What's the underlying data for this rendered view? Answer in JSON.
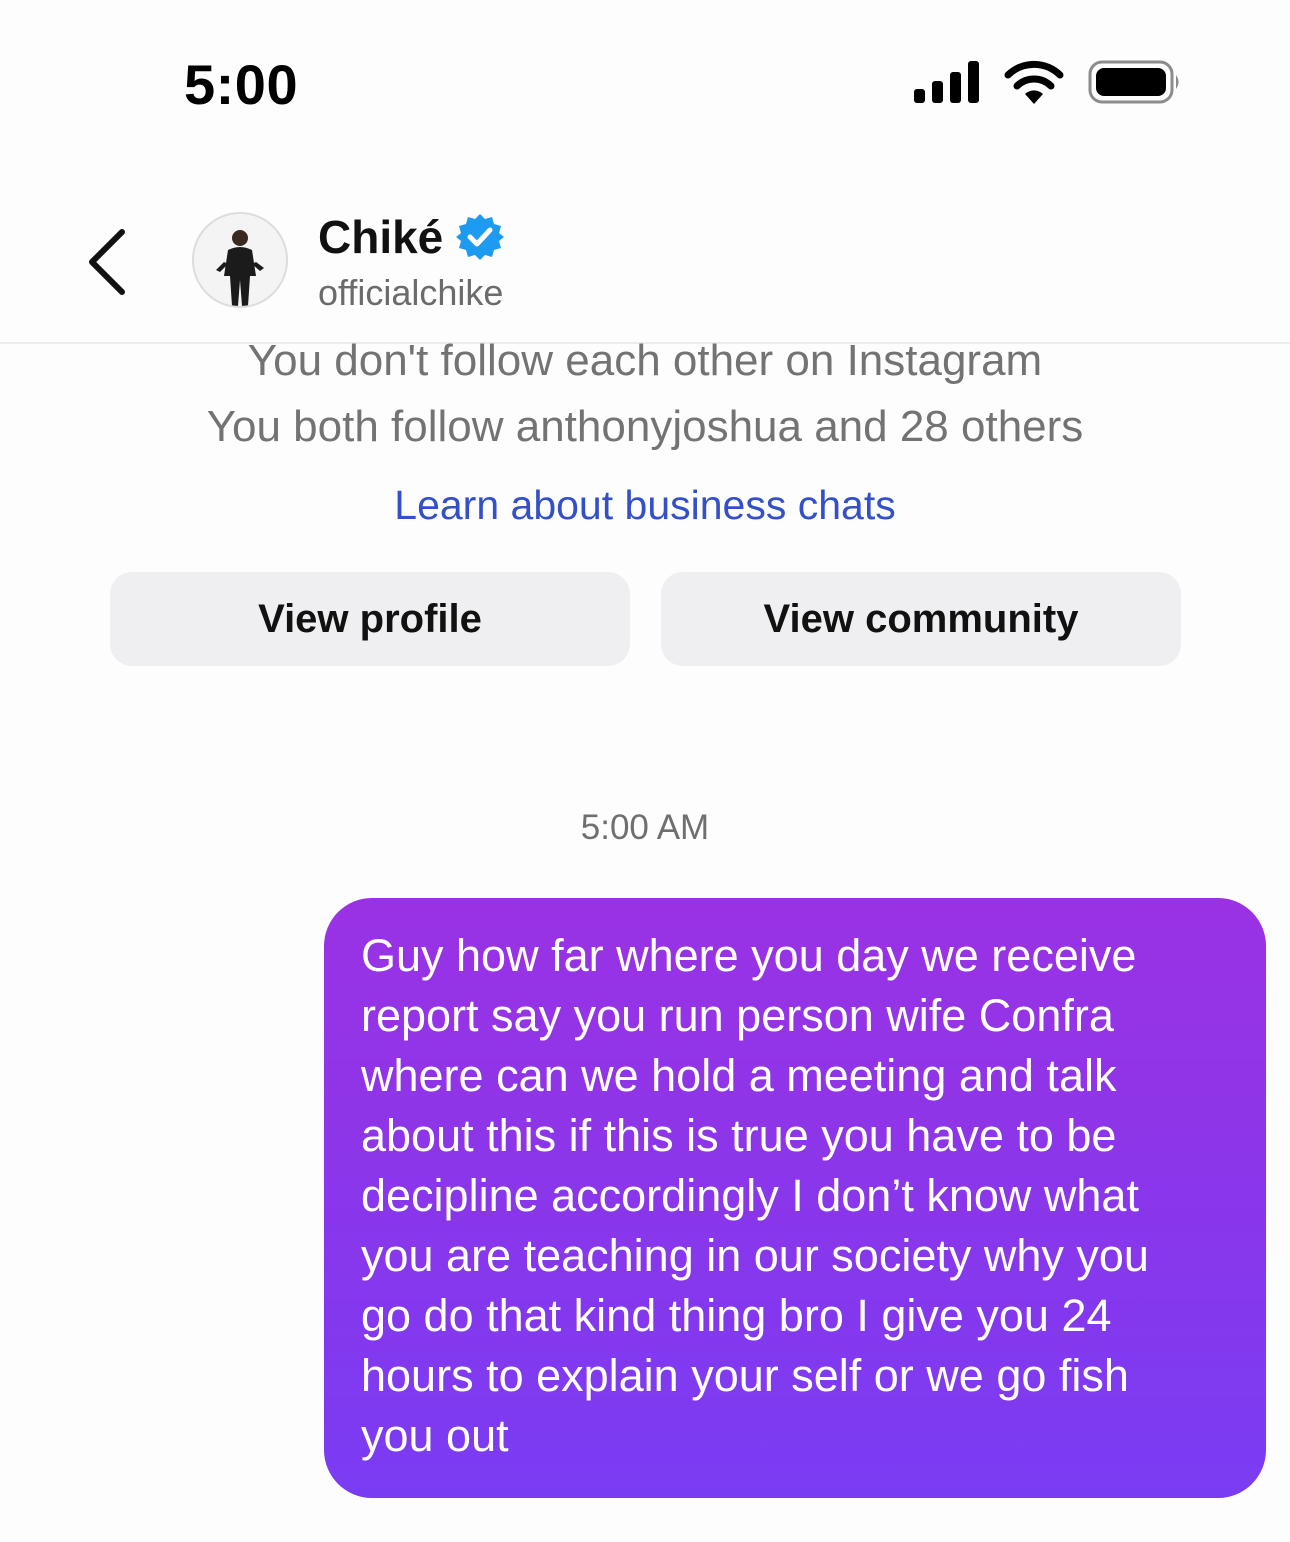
{
  "status_bar": {
    "time": "5:00"
  },
  "header": {
    "back_icon": "chevron-left-icon",
    "name": "Chiké",
    "verified_icon": "verified-badge-icon",
    "username": "officialchike"
  },
  "info": {
    "line1": "You don't follow each other on Instagram",
    "line2": "You both follow anthonyjoshua and 28 others",
    "learn_link": "Learn about business chats"
  },
  "actions": {
    "view_profile": "View profile",
    "view_community": "View community"
  },
  "thread": {
    "timestamp": "5:00 AM",
    "message": {
      "lines": [
        "Guy how far where you day we receive",
        "report say you run person wife Confra",
        "where can we hold a meeting and talk",
        "about this if this is true you have to be",
        "decipline accordingly I don’t know what",
        "you are teaching in our society why you",
        "go do that kind thing bro I give you 24",
        "hours to explain your self or we go fish",
        "you out"
      ]
    }
  },
  "colors": {
    "bubble_top": "#9a32e4",
    "bubble_bottom": "#7a3cf3",
    "link": "#3450c8",
    "verified": "#1d9bf0"
  }
}
